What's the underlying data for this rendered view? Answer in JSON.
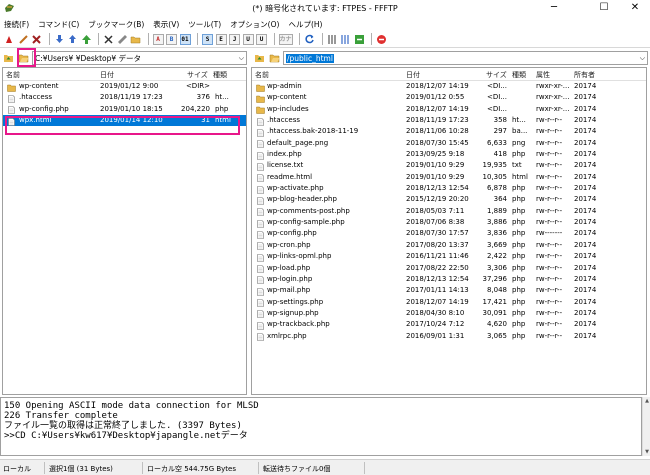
{
  "window": {
    "title": "(*) 暗号化されています: FTPES - FFFTP",
    "minimize": "─",
    "maximize": "☐",
    "close": "✕"
  },
  "menu": [
    "接続(F)",
    "コマンド(C)",
    "ブックマーク(B)",
    "表示(V)",
    "ツール(T)",
    "オプション(O)",
    "ヘルプ(H)"
  ],
  "toolbar": {
    "text_buttons": [
      "S",
      "E",
      "J",
      "U",
      "U",
      "カナ"
    ],
    "tb_a": "A",
    "tb_b": "B",
    "tb_bin": "01"
  },
  "local": {
    "path": "C:¥Users¥            ¥Desktop¥            データ",
    "columns": [
      "名前",
      "日付",
      "サイズ",
      "種類"
    ],
    "files": [
      {
        "name": "wp-content",
        "date": "2019/01/12  9:00",
        "size": "<DIR>",
        "type": "",
        "kind": "folder"
      },
      {
        "name": ".htaccess",
        "date": "2018/11/19 17:23",
        "size": "376",
        "type": "ht...",
        "kind": "file"
      },
      {
        "name": "wp-config.php",
        "date": "2019/01/10 18:15",
        "size": "204,220",
        "type": "php",
        "kind": "file"
      },
      {
        "name": "wpx.html",
        "date": "2019/01/14 12:10",
        "size": "31",
        "type": "html",
        "kind": "file",
        "selected": true
      }
    ]
  },
  "remote": {
    "path": "/public_html",
    "columns": [
      "名前",
      "日付",
      "サイズ",
      "種類",
      "属性",
      "所有者"
    ],
    "files": [
      {
        "name": "wp-admin",
        "date": "2018/12/07 14:19",
        "size": "<DI...",
        "type": "",
        "attr": "rwxr-xr-...",
        "owner": "20174",
        "kind": "folder"
      },
      {
        "name": "wp-content",
        "date": "2019/01/12  0:55",
        "size": "<DI...",
        "type": "",
        "attr": "rwxr-xr-...",
        "owner": "20174",
        "kind": "folder"
      },
      {
        "name": "wp-includes",
        "date": "2018/12/07 14:19",
        "size": "<DI...",
        "type": "",
        "attr": "rwxr-xr-...",
        "owner": "20174",
        "kind": "folder"
      },
      {
        "name": ".htaccess",
        "date": "2018/11/19 17:23",
        "size": "358",
        "type": "ht...",
        "attr": "rw-r--r--",
        "owner": "20174",
        "kind": "file"
      },
      {
        "name": ".htaccess.bak-2018-11-19",
        "date": "2018/11/06 10:28",
        "size": "297",
        "type": "ba...",
        "attr": "rw-r--r--",
        "owner": "20174",
        "kind": "file"
      },
      {
        "name": "default_page.png",
        "date": "2018/07/30 15:45",
        "size": "6,633",
        "type": "png",
        "attr": "rw-r--r--",
        "owner": "20174",
        "kind": "file"
      },
      {
        "name": "index.php",
        "date": "2013/09/25  9:18",
        "size": "418",
        "type": "php",
        "attr": "rw-r--r--",
        "owner": "20174",
        "kind": "file"
      },
      {
        "name": "license.txt",
        "date": "2019/01/10  9:29",
        "size": "19,935",
        "type": "txt",
        "attr": "rw-r--r--",
        "owner": "20174",
        "kind": "file"
      },
      {
        "name": "readme.html",
        "date": "2019/01/10  9:29",
        "size": "10,305",
        "type": "html",
        "attr": "rw-r--r--",
        "owner": "20174",
        "kind": "file"
      },
      {
        "name": "wp-activate.php",
        "date": "2018/12/13 12:54",
        "size": "6,878",
        "type": "php",
        "attr": "rw-r--r--",
        "owner": "20174",
        "kind": "file"
      },
      {
        "name": "wp-blog-header.php",
        "date": "2015/12/19 20:20",
        "size": "364",
        "type": "php",
        "attr": "rw-r--r--",
        "owner": "20174",
        "kind": "file"
      },
      {
        "name": "wp-comments-post.php",
        "date": "2018/05/03  7:11",
        "size": "1,889",
        "type": "php",
        "attr": "rw-r--r--",
        "owner": "20174",
        "kind": "file"
      },
      {
        "name": "wp-config-sample.php",
        "date": "2018/07/06  8:38",
        "size": "3,886",
        "type": "php",
        "attr": "rw-r--r--",
        "owner": "20174",
        "kind": "file"
      },
      {
        "name": "wp-config.php",
        "date": "2018/07/30 17:57",
        "size": "3,836",
        "type": "php",
        "attr": "rw-------",
        "owner": "20174",
        "kind": "file"
      },
      {
        "name": "wp-cron.php",
        "date": "2017/08/20 13:37",
        "size": "3,669",
        "type": "php",
        "attr": "rw-r--r--",
        "owner": "20174",
        "kind": "file"
      },
      {
        "name": "wp-links-opml.php",
        "date": "2016/11/21 11:46",
        "size": "2,422",
        "type": "php",
        "attr": "rw-r--r--",
        "owner": "20174",
        "kind": "file"
      },
      {
        "name": "wp-load.php",
        "date": "2017/08/22 22:50",
        "size": "3,306",
        "type": "php",
        "attr": "rw-r--r--",
        "owner": "20174",
        "kind": "file"
      },
      {
        "name": "wp-login.php",
        "date": "2018/12/13 12:54",
        "size": "37,296",
        "type": "php",
        "attr": "rw-r--r--",
        "owner": "20174",
        "kind": "file"
      },
      {
        "name": "wp-mail.php",
        "date": "2017/01/11 14:13",
        "size": "8,048",
        "type": "php",
        "attr": "rw-r--r--",
        "owner": "20174",
        "kind": "file"
      },
      {
        "name": "wp-settings.php",
        "date": "2018/12/07 14:19",
        "size": "17,421",
        "type": "php",
        "attr": "rw-r--r--",
        "owner": "20174",
        "kind": "file"
      },
      {
        "name": "wp-signup.php",
        "date": "2018/04/30  8:10",
        "size": "30,091",
        "type": "php",
        "attr": "rw-r--r--",
        "owner": "20174",
        "kind": "file"
      },
      {
        "name": "wp-trackback.php",
        "date": "2017/10/24  7:12",
        "size": "4,620",
        "type": "php",
        "attr": "rw-r--r--",
        "owner": "20174",
        "kind": "file"
      },
      {
        "name": "xmlrpc.php",
        "date": "2016/09/01  1:31",
        "size": "3,065",
        "type": "php",
        "attr": "rw-r--r--",
        "owner": "20174",
        "kind": "file"
      }
    ]
  },
  "log": [
    "150 Opening ASCII mode data connection for MLSD",
    "226 Transfer complete",
    "ファイル一覧の取得は正常終了しました. (3397 Bytes)",
    ">>CD C:¥Users¥kw617¥Desktop¥japangle.netデータ"
  ],
  "status": {
    "side": "ローカル",
    "selection": "選択1個 (31 Bytes)",
    "free": "ローカル空 544.75G Bytes",
    "queue": "転送待ちファイル0個"
  },
  "colors": {
    "selection": "#0078d7",
    "highlight": "#e8178a",
    "folder": "#e8b84a"
  }
}
